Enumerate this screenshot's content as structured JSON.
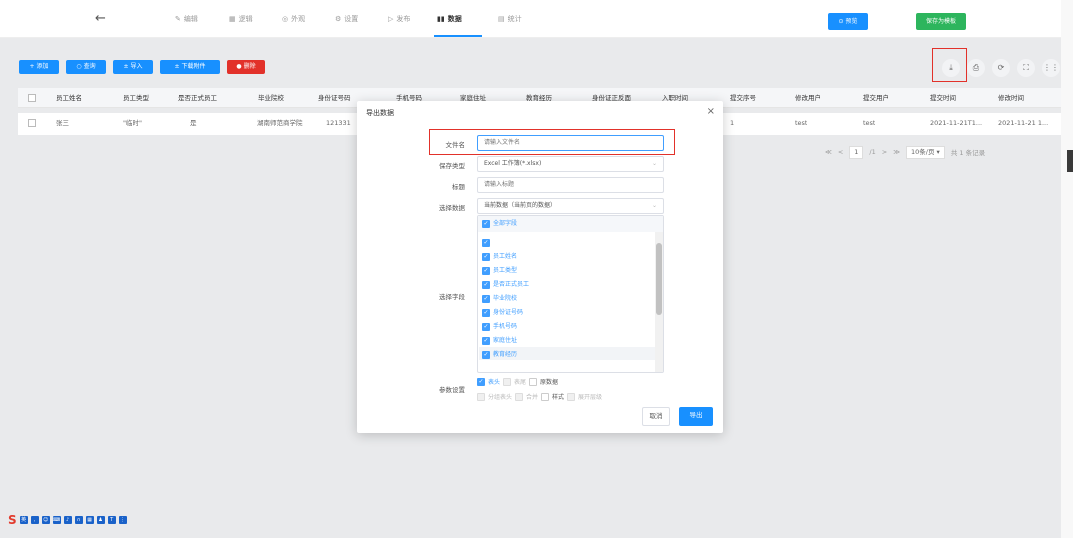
{
  "header": {
    "back_icon": "arrow-left-icon",
    "nav": [
      {
        "icon": "edit-icon",
        "label": "编辑"
      },
      {
        "icon": "grid-icon",
        "label": "逻辑"
      },
      {
        "icon": "eye-icon",
        "label": "外观"
      },
      {
        "icon": "gear-icon",
        "label": "设置"
      },
      {
        "icon": "play-icon",
        "label": "发布"
      },
      {
        "icon": "chart-bar-icon",
        "label": "数据"
      },
      {
        "icon": "stats-icon",
        "label": "统计"
      }
    ],
    "preview_label": "⊙ 预览",
    "save_template_label": "保存为模板"
  },
  "toolbar": {
    "add": "+ 添加",
    "query": "○ 查询",
    "import": "± 导入",
    "download_attach": "± 下载附件",
    "delete": "● 删除"
  },
  "table": {
    "columns": [
      "员工姓名",
      "员工类型",
      "是否正式员工",
      "毕业院校",
      "身份证号码",
      "手机号码",
      "家庭住址",
      "教育经历",
      "身份证正反面",
      "入职时间",
      "提交序号",
      "修改用户",
      "提交用户",
      "提交时间",
      "修改时间"
    ],
    "rows": [
      [
        "张三",
        "\"临时\"",
        "是",
        "湖南师范商学院",
        "121331",
        "",
        "",
        "",
        "",
        "",
        "1",
        "test",
        "test",
        "2021-11-21T1...",
        "2021-11-21 1..."
      ]
    ]
  },
  "pager": {
    "first": "≪",
    "prev": "<",
    "page": "1",
    "total_pages": "/1",
    "next": ">",
    "last": "≫",
    "page_size": "10条/页",
    "total": "共 1 条记录"
  },
  "dialog": {
    "title": "导出数据",
    "close": "×",
    "file_name_label": "文件名",
    "file_name_placeholder": "请输入文件名",
    "save_type_label": "保存类型",
    "save_type_value": "Excel 工作簿(*.xlsx)",
    "caption_label": "标题",
    "caption_placeholder": "请输入标题",
    "select_data_label": "选择数据",
    "select_data_value": "当前数据（当前页的数据）",
    "fields_label": "选择字段",
    "fields_all": "全部字段",
    "fields": [
      "",
      "员工姓名",
      "员工类型",
      "是否正式员工",
      "毕业院校",
      "身份证号码",
      "手机号码",
      "家庭住址",
      "教育经历"
    ],
    "params_label": "参数设置",
    "params_row1": [
      "表头",
      "表尾",
      "原数据"
    ],
    "params_row2": [
      "分组表头",
      "合并",
      "样式",
      "展开层级"
    ],
    "cancel_label": "取消",
    "export_label": "导出"
  },
  "colors": {
    "primary": "#1890ff",
    "danger": "#e2312a",
    "success": "#2db55d",
    "checkbox": "#409eff"
  }
}
